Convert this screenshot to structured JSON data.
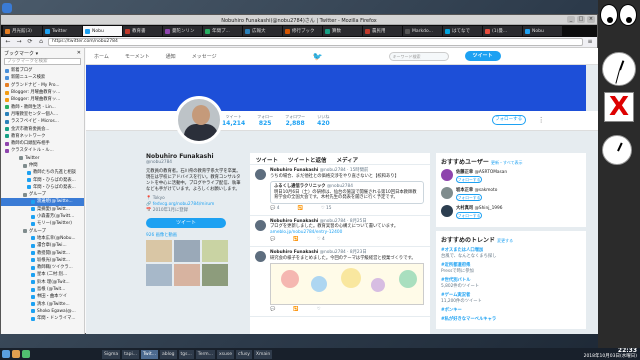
{
  "window": {
    "title": "Nobuhiro Funakashi(@nobu2784)さん | Twitter - Mozilla Firefox"
  },
  "tabs": [
    {
      "label": "月光館(3)",
      "color": "#e67e22",
      "active": false
    },
    {
      "label": "Twitter",
      "color": "#1da1f2",
      "active": false
    },
    {
      "label": "Nobu",
      "color": "#1da1f2",
      "active": true
    },
    {
      "label": "教育書",
      "color": "#c0392b",
      "active": false
    },
    {
      "label": "曼陀ンリン",
      "color": "#8e44ad",
      "active": false
    },
    {
      "label": "年間プ...",
      "color": "#27ae60",
      "active": false
    },
    {
      "label": "広報大",
      "color": "#2980b9",
      "active": false
    },
    {
      "label": "修行ブック",
      "color": "#d35400",
      "active": false
    },
    {
      "label": "算数",
      "color": "#16a085",
      "active": false
    },
    {
      "label": "農民用",
      "color": "#c0392b",
      "active": false
    },
    {
      "label": "Markdo...",
      "color": "#555555",
      "active": false
    },
    {
      "label": "はてなで",
      "color": "#00a4de",
      "active": false
    },
    {
      "label": "(1)曼...",
      "color": "#e74c3c",
      "active": false
    },
    {
      "label": "Nobu",
      "color": "#1da1f2",
      "active": false
    }
  ],
  "navbar": {
    "back": "←",
    "forward": "→",
    "reload": "⟳",
    "home": "⌂",
    "url": "https://twitter.com/nobu2784",
    "menu": "≡"
  },
  "sidebar": {
    "title": "ブックマーク ▾",
    "close": "✕",
    "search_placeholder": "ブックマークを検索",
    "items": [
      {
        "label": "新着ブログ",
        "indent": 4,
        "color": "#4a90d9",
        "selected": false
      },
      {
        "label": "新聞ニュース検索",
        "indent": 4,
        "color": "#4a90d9",
        "selected": false
      },
      {
        "label": "グランドナビ - My Pro...",
        "indent": 4,
        "color": "#e67e22",
        "selected": false
      },
      {
        "label": "Blogger: 月曜曲教育ッ...",
        "indent": 4,
        "color": "#f39c12",
        "selected": false
      },
      {
        "label": "Blogger: 月曜曲教育ッ...",
        "indent": 4,
        "color": "#f39c12",
        "selected": false
      },
      {
        "label": "教師・教師生活 - Lin...",
        "indent": 4,
        "color": "#27ae60",
        "selected": false
      },
      {
        "label": "月曜教室センター個人...",
        "indent": 4,
        "color": "#2980b9",
        "selected": false
      },
      {
        "label": "ラスフペイビ - Micros...",
        "indent": 4,
        "color": "#2980b9",
        "selected": false
      },
      {
        "label": "金沢市教育委員会...",
        "indent": 4,
        "color": "#16a085",
        "selected": false
      },
      {
        "label": "教育ネットワーク",
        "indent": 4,
        "color": "#16a085",
        "selected": false
      },
      {
        "label": "教師の口頭配布相手",
        "indent": 4,
        "color": "#8e44ad",
        "selected": false
      },
      {
        "label": "クラスタイトル・ル...",
        "indent": 4,
        "color": "#8e44ad",
        "selected": false
      },
      {
        "label": "Twitter",
        "indent": 18,
        "color": "#7f8c8d",
        "selected": false
      },
      {
        "label": "仲間",
        "indent": 22,
        "color": "#7f8c8d",
        "selected": false
      },
      {
        "label": "教師たちの先進と相談",
        "indent": 26,
        "color": "#1da1f2",
        "selected": false
      },
      {
        "label": "年間・ひらばの発表...",
        "indent": 26,
        "color": "#1da1f2",
        "selected": false
      },
      {
        "label": "年間・ひらばの発表...",
        "indent": 26,
        "color": "#1da1f2",
        "selected": false
      },
      {
        "label": "グループ",
        "indent": 22,
        "color": "#7f8c8d",
        "selected": false
      },
      {
        "label": "渡邊暁(@Twitte...",
        "indent": 30,
        "color": "#1da1f2",
        "selected": true
      },
      {
        "label": "菜摘愛(@Twitt...",
        "indent": 30,
        "color": "#1da1f2",
        "selected": false
      },
      {
        "label": "小森書芳(@Twitt...",
        "indent": 30,
        "color": "#1da1f2",
        "selected": false
      },
      {
        "label": "モリー(@Twitter)",
        "indent": 30,
        "color": "#1da1f2",
        "selected": false
      },
      {
        "label": "グループ",
        "indent": 22,
        "color": "#7f8c8d",
        "selected": false
      },
      {
        "label": "地本広幸(@Nobu...",
        "indent": 30,
        "color": "#1da1f2",
        "selected": false
      },
      {
        "label": "濃合章(@Twi...",
        "indent": 30,
        "color": "#1da1f2",
        "selected": false
      },
      {
        "label": "教授開(@Twitt...",
        "indent": 30,
        "color": "#1da1f2",
        "selected": false
      },
      {
        "label": "坂根光(@Twitt...",
        "indent": 30,
        "color": "#1da1f2",
        "selected": false
      },
      {
        "label": "教師職(ツイクラ...",
        "indent": 30,
        "color": "#1da1f2",
        "selected": false
      },
      {
        "label": "星本 (二村:別...",
        "indent": 30,
        "color": "#1da1f2",
        "selected": false
      },
      {
        "label": "鈴木 理(@Twit...",
        "indent": 30,
        "color": "#1da1f2",
        "selected": false
      },
      {
        "label": "島根 (@Twit...",
        "indent": 30,
        "color": "#1da1f2",
        "selected": false
      },
      {
        "label": "林田・曲本ツイ",
        "indent": 30,
        "color": "#1da1f2",
        "selected": false
      },
      {
        "label": "清水 (@Twitte...",
        "indent": 30,
        "color": "#1da1f2",
        "selected": false
      },
      {
        "label": "Shoko Egawa(@...",
        "indent": 30,
        "color": "#1da1f2",
        "selected": false
      },
      {
        "label": "年間・ドンライマ...",
        "indent": 30,
        "color": "#1da1f2",
        "selected": false
      }
    ]
  },
  "twitter": {
    "nav": {
      "home": "ホーム",
      "moments": "モーメント",
      "notifications": "通知",
      "messages": "メッセージ",
      "search_placeholder": "キーワード検索",
      "tweet_button": "ツイート"
    },
    "stats": [
      {
        "label": "ツイート",
        "value": "14,214"
      },
      {
        "label": "フォロー",
        "value": "825"
      },
      {
        "label": "フォロワー",
        "value": "2,888"
      },
      {
        "label": "いいね",
        "value": "420"
      }
    ],
    "follow_button": "フォローする",
    "more": "⋮",
    "profile": {
      "name": "Nobuhiro Funakashi",
      "handle": "@nobu2784",
      "bio": "元教員の教育者。石川県の教育学系大学を卒業。現在は学校にアドバイスを行い。教育コンサルタントを中心に活動中。ブログやライブ配信、執筆なども手がけています。よろしくお願いします。",
      "location": "Tokyo",
      "link": "fedvcg.org/nobu2784/mirum",
      "joined": "2010年1月に登録",
      "tweet_to": "ツイート",
      "media_title": "926 画像と動画"
    },
    "timeline": {
      "tabs": [
        "ツイート",
        "ツイートと返信",
        "メディア"
      ],
      "tweets": [
        {
          "name": "Nobuhiro Funakashi",
          "meta": "@nobu2784 · 15時間前",
          "text": "うちの場合、まだ他社との価格交渉をやり直さないと【校和あり】",
          "quote_name": "ふるくし通信ラクリニック",
          "quote_meta": "@nobu2784",
          "quote_text": "明日10月6日（土）の研修は、仙台の施設で開催される第10回日本教師教育学会の全国大会です。木村先生の発表を聞きに行く予定です。",
          "replies": "4",
          "retweets": "",
          "likes": "15"
        },
        {
          "name": "Nobuhiro Funakashi",
          "meta": "@nobu2784 · 8月25日",
          "text": "ブログを更新しました。教育実習の心構えについて書いています。",
          "link": "ameblo.jp/nobu2784/entry-12400",
          "replies": "",
          "retweets": "",
          "likes": "4"
        },
        {
          "name": "Nobuhiro Funakashi",
          "meta": "@nobu2784 · 8月23日",
          "text": "研究会の様子をまとめました。今回のテーマは学級経営と授業づくりです。",
          "replies": "",
          "retweets": "",
          "likes": ""
        }
      ]
    },
    "who_to_follow": {
      "title": "おすすめユーザー",
      "links": "更新・すべて表示",
      "users": [
        {
          "name": "佐藤正幸",
          "handle": "@ASRTOMasan",
          "button": "フォローする",
          "color": "#8e44ad"
        },
        {
          "name": "坂本正幸",
          "handle": "@sakmoto",
          "button": "フォローする",
          "color": "#7f8c8d"
        },
        {
          "name": "大村真司",
          "handle": "@Shinj_1996",
          "button": "フォローする",
          "color": "#2c3e50"
        }
      ]
    },
    "trends": {
      "title": "おすすめのトレンド",
      "links": "変更する",
      "items": [
        {
          "tag": "#オスまたは人口増加",
          "desc": "台風で、なんとなくまち探し"
        },
        {
          "tag": "#近所都道府県",
          "desc": "Pressで時に参加"
        },
        {
          "tag": "#世代別バトル",
          "desc": "5,802件のツイート"
        },
        {
          "tag": "#ゲーム実況者",
          "desc": "11,200件のツイート"
        },
        {
          "tag": "#ポンキー",
          "desc": ""
        },
        {
          "tag": "#私が好きなマーベルキャラ",
          "desc": ""
        }
      ]
    }
  },
  "taskbar": {
    "tasks": [
      {
        "label": "Sigma",
        "active": false
      },
      {
        "label": "tapi...",
        "active": false
      },
      {
        "label": "Twit...",
        "active": true
      },
      {
        "label": "ablog",
        "active": false
      },
      {
        "label": "tgs...",
        "active": false
      },
      {
        "label": "Term...",
        "active": false
      },
      {
        "label": "xsuse",
        "active": false
      },
      {
        "label": "cfusy",
        "active": false
      },
      {
        "label": "Xmain",
        "active": false
      }
    ],
    "clock_time": "22:33",
    "clock_date": "2018年10月03日(水曜日)"
  }
}
